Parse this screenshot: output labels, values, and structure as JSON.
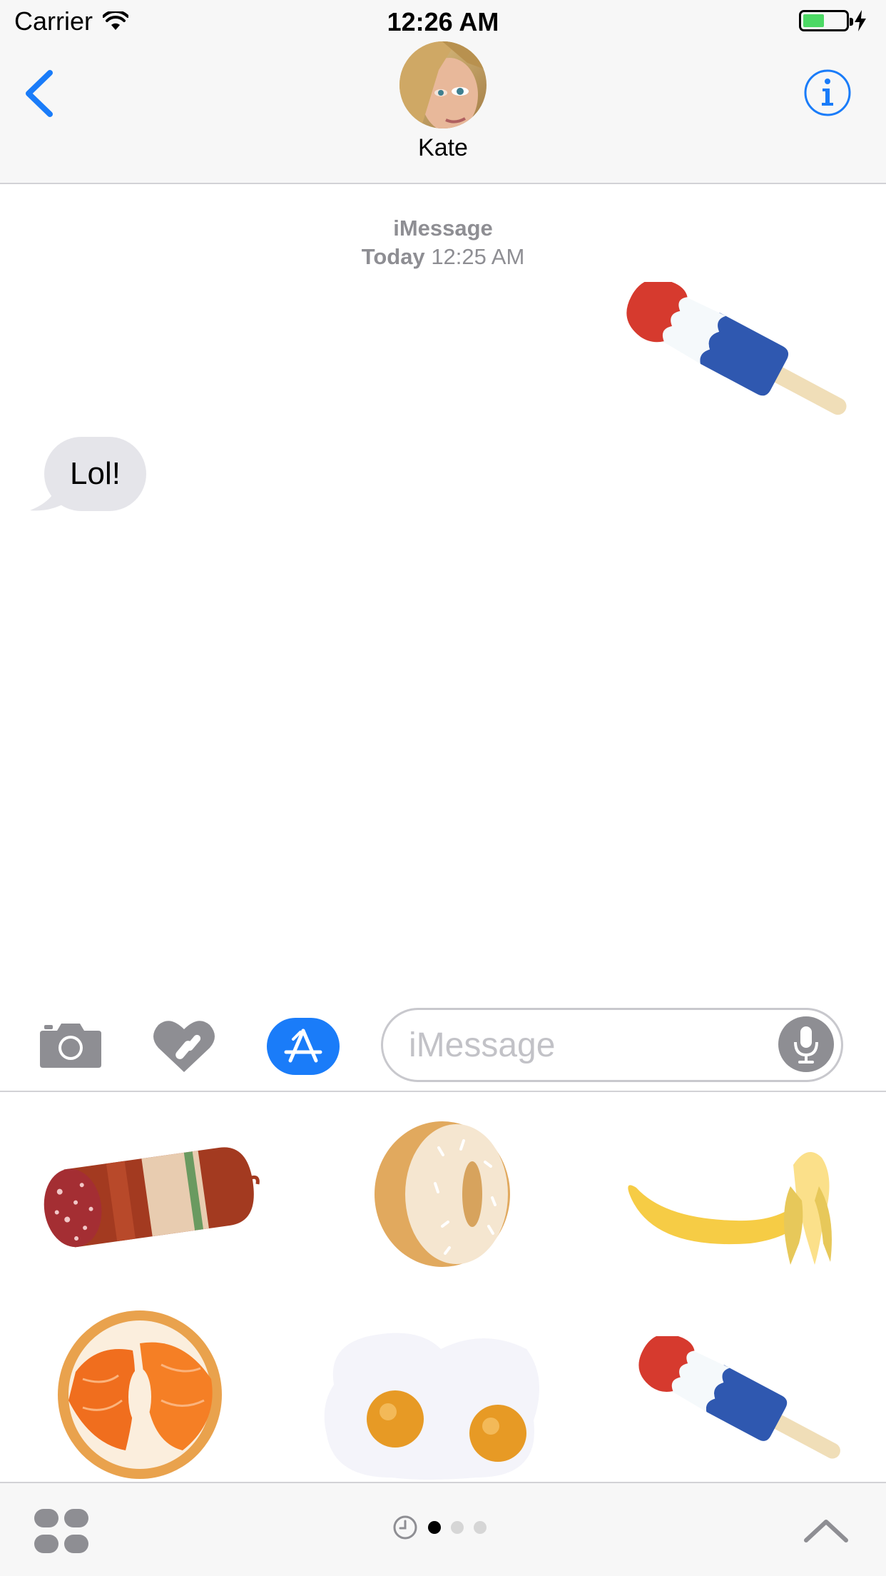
{
  "status_bar": {
    "carrier": "Carrier",
    "time": "12:26 AM",
    "battery_level": 0.5,
    "charging": true
  },
  "nav": {
    "contact_name": "Kate",
    "back_icon": "chevron-left-icon",
    "info_icon": "info-icon"
  },
  "conversation": {
    "service": "iMessage",
    "day": "Today",
    "time": "12:25 AM",
    "messages": [
      {
        "from": "me",
        "kind": "sticker",
        "sticker": "rocket-popsicle"
      },
      {
        "from": "contact",
        "kind": "text",
        "text": "Lol!"
      }
    ]
  },
  "compose": {
    "placeholder": "iMessage",
    "value": "",
    "buttons": [
      "camera-icon",
      "digital-touch-icon",
      "app-store-icon",
      "microphone-icon"
    ]
  },
  "sticker_drawer": {
    "stickers": [
      "salami",
      "donut",
      "banana",
      "salmon-bagel",
      "fried-eggs",
      "rocket-popsicle"
    ],
    "pages": 3,
    "active_page": 1
  },
  "colors": {
    "accent": "#1a7cf9",
    "received_bubble": "#e5e5ea",
    "meta_text": "#8e8e93",
    "battery": "#4cd964"
  }
}
